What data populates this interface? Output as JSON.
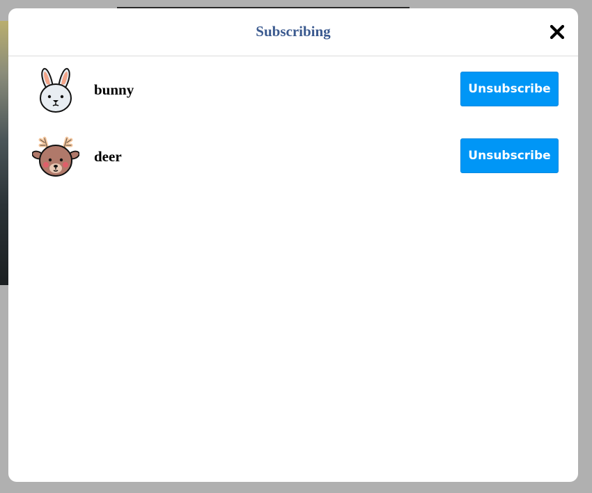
{
  "modal": {
    "title": "Subscribing",
    "close_icon": "close-icon"
  },
  "subscriptions": [
    {
      "name": "bunny",
      "avatar_icon": "bunny-avatar",
      "button_label": "Unsubscribe"
    },
    {
      "name": "deer",
      "avatar_icon": "deer-avatar",
      "button_label": "Unsubscribe"
    }
  ],
  "colors": {
    "title": "#3b5a8f",
    "button": "#0096f6",
    "overlay": "#b3b3b3"
  }
}
